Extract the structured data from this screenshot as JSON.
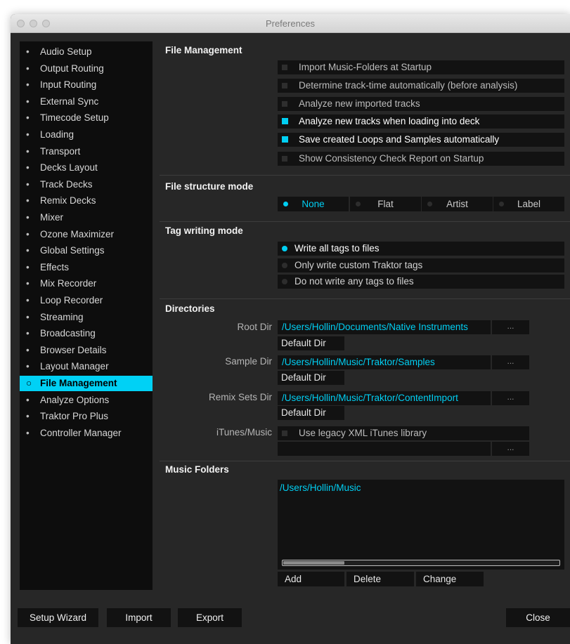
{
  "window": {
    "title": "Preferences"
  },
  "sidebar": {
    "items": [
      {
        "label": "Audio Setup",
        "active": false
      },
      {
        "label": "Output Routing",
        "active": false
      },
      {
        "label": "Input Routing",
        "active": false
      },
      {
        "label": "External Sync",
        "active": false
      },
      {
        "label": "Timecode Setup",
        "active": false
      },
      {
        "label": "Loading",
        "active": false
      },
      {
        "label": "Transport",
        "active": false
      },
      {
        "label": "Decks Layout",
        "active": false
      },
      {
        "label": "Track Decks",
        "active": false
      },
      {
        "label": "Remix Decks",
        "active": false
      },
      {
        "label": "Mixer",
        "active": false
      },
      {
        "label": "Ozone Maximizer",
        "active": false
      },
      {
        "label": "Global Settings",
        "active": false
      },
      {
        "label": "Effects",
        "active": false
      },
      {
        "label": "Mix Recorder",
        "active": false
      },
      {
        "label": "Loop Recorder",
        "active": false
      },
      {
        "label": "Streaming",
        "active": false
      },
      {
        "label": "Broadcasting",
        "active": false
      },
      {
        "label": "Browser Details",
        "active": false
      },
      {
        "label": "Layout Manager",
        "active": false
      },
      {
        "label": "File Management",
        "active": true
      },
      {
        "label": "Analyze Options",
        "active": false
      },
      {
        "label": "Traktor Pro Plus",
        "active": false
      },
      {
        "label": "Controller Manager",
        "active": false
      }
    ]
  },
  "file_management": {
    "title": "File Management",
    "options": [
      {
        "label": "Import Music-Folders at Startup",
        "checked": false
      },
      {
        "label": "Determine track-time automatically (before analysis)",
        "checked": false
      },
      {
        "label": "Analyze new imported tracks",
        "checked": false
      },
      {
        "label": "Analyze new tracks when loading into deck",
        "checked": true
      },
      {
        "label": "Save created Loops and Samples automatically",
        "checked": true
      },
      {
        "label": "Show Consistency Check Report on Startup",
        "checked": false
      }
    ]
  },
  "file_structure": {
    "title": "File structure mode",
    "options": [
      {
        "label": "None",
        "selected": true
      },
      {
        "label": "Flat",
        "selected": false
      },
      {
        "label": "Artist",
        "selected": false
      },
      {
        "label": "Label",
        "selected": false
      }
    ]
  },
  "tag_writing": {
    "title": "Tag writing mode",
    "options": [
      {
        "label": "Write all tags to files",
        "selected": true
      },
      {
        "label": "Only write custom Traktor tags",
        "selected": false
      },
      {
        "label": "Do not write any tags to files",
        "selected": false
      }
    ]
  },
  "directories": {
    "title": "Directories",
    "root": {
      "label": "Root Dir",
      "value": "/Users/Hollin/Documents/Native Instruments",
      "default_label": "Default Dir"
    },
    "sample": {
      "label": "Sample Dir",
      "value": "/Users/Hollin/Music/Traktor/Samples",
      "default_label": "Default Dir"
    },
    "remix": {
      "label": "Remix Sets Dir",
      "value": "/Users/Hollin/Music/Traktor/ContentImport",
      "default_label": "Default Dir"
    },
    "itunes": {
      "label": "iTunes/Music",
      "checkbox_label": "Use legacy XML iTunes library",
      "checked": false,
      "value": ""
    },
    "browse_label": "..."
  },
  "music_folders": {
    "title": "Music Folders",
    "entries": [
      "/Users/Hollin/Music"
    ],
    "scroll_position": 0.22,
    "add_label": "Add",
    "delete_label": "Delete",
    "change_label": "Change"
  },
  "footer": {
    "setup_wizard": "Setup Wizard",
    "import": "Import",
    "export": "Export",
    "close": "Close"
  },
  "colors": {
    "accent": "#00cff3",
    "background": "#272727",
    "field": "#121212",
    "sidebar": "#0d0d0d"
  }
}
